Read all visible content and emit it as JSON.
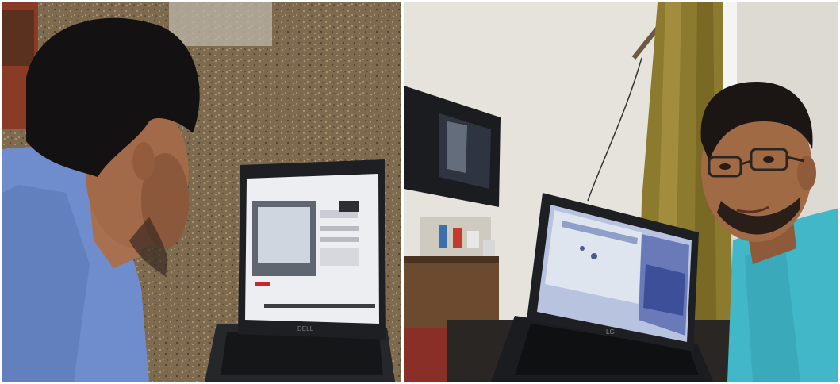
{
  "photos": [
    {
      "scene": "man-in-blue-shirt-looking-at-laptop",
      "laptop_brand": "DELL"
    },
    {
      "scene": "man-in-teal-shirt-selfie-with-laptop",
      "laptop_brand": "LG"
    }
  ],
  "colors": {
    "floor": "#7d6a4f",
    "wall": "#e6e3dd",
    "shirt_blue": "#6f8ccc",
    "shirt_teal": "#42b7c8",
    "curtain": "#8c7a2e",
    "screen_glow": "#e8ecf2",
    "laptop_body": "#1e1f22"
  }
}
